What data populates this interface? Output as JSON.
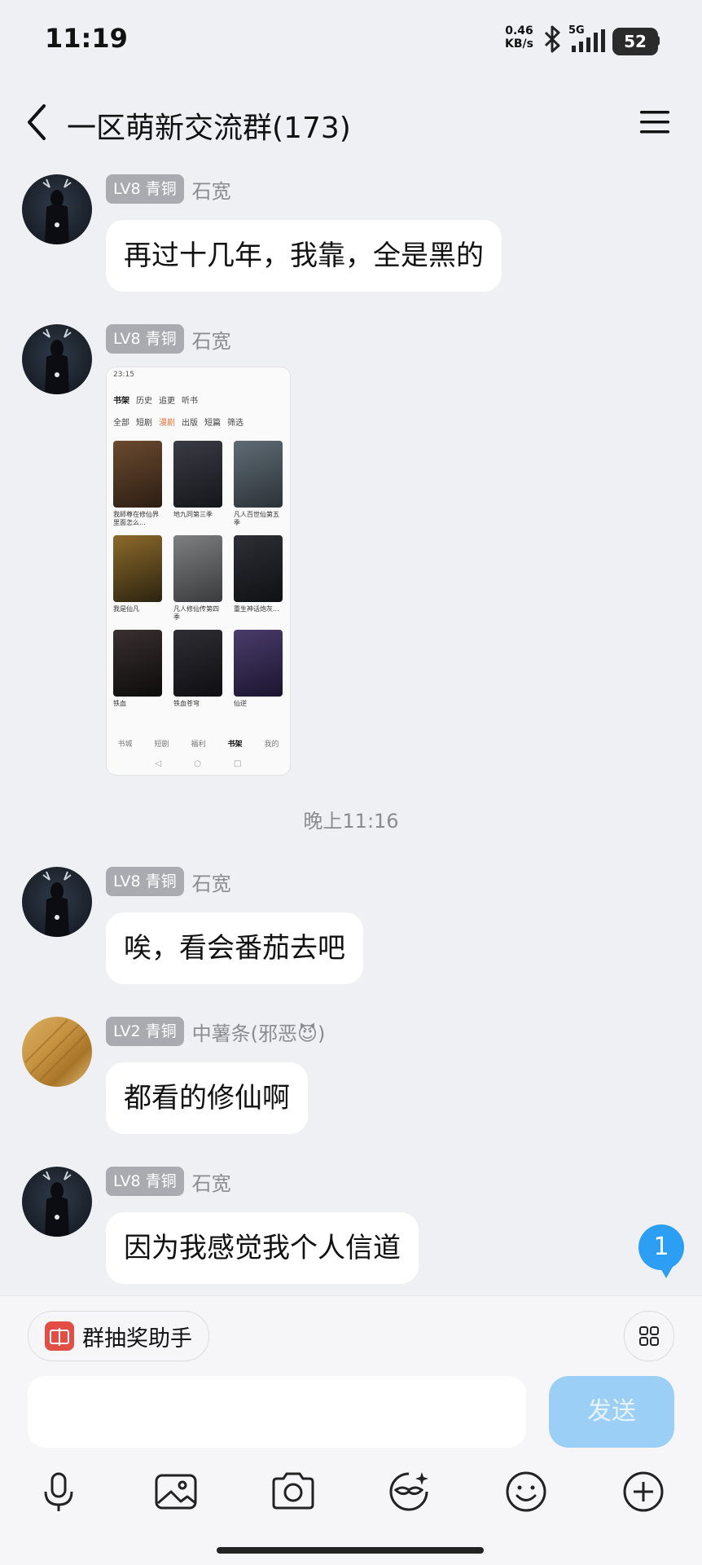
{
  "status": {
    "time": "11:19",
    "net_speed": "0.46",
    "net_unit": "KB/s",
    "signal": "5G",
    "battery": "52"
  },
  "header": {
    "title": "一区萌新交流群(173)",
    "back_icon": "chevron-left-icon",
    "menu_icon": "menu-icon"
  },
  "messages": [
    {
      "level": "LV8 青铜",
      "sender": "石宽",
      "text": "再过十几年，我靠，全是黑的",
      "avatar": "deer"
    },
    {
      "level": "LV8 青铜",
      "sender": "石宽",
      "type": "image",
      "avatar": "deer"
    },
    {
      "level": "LV8 青铜",
      "sender": "石宽",
      "text": "唉，看会番茄去吧",
      "avatar": "deer"
    },
    {
      "level": "LV2 青铜",
      "sender": "中薯条(邪恶😈)",
      "text": "都看的修仙啊",
      "avatar": "fries"
    },
    {
      "level": "LV8 青铜",
      "sender": "石宽",
      "text": "因为我感觉我个人信道",
      "avatar": "deer"
    }
  ],
  "image_preview": {
    "time": "23:15",
    "tabs": [
      "书架",
      "历史",
      "追更",
      "听书"
    ],
    "filters": [
      "全部",
      "短剧",
      "漫剧",
      "出版",
      "短篇",
      "筛选"
    ],
    "books": [
      "我師尊在修仙界里面怎么...",
      "地九同第三季",
      "凡人百世仙第五季",
      "我是仙凡",
      "凡人修仙传第四季",
      "重生神话炮灰...",
      "铁血",
      "铁血苍穹",
      "仙逆"
    ],
    "nav": [
      "书城",
      "短剧",
      "福利",
      "书架",
      "我的"
    ]
  },
  "timestamp": "晚上11:16",
  "unread_count": "1",
  "bottom": {
    "assistant_label": "群抽奖助手",
    "send_label": "发送",
    "input_placeholder": "",
    "tools": [
      "microphone-icon",
      "image-icon",
      "camera-icon",
      "sticker-icon",
      "emoji-icon",
      "plus-icon"
    ]
  }
}
